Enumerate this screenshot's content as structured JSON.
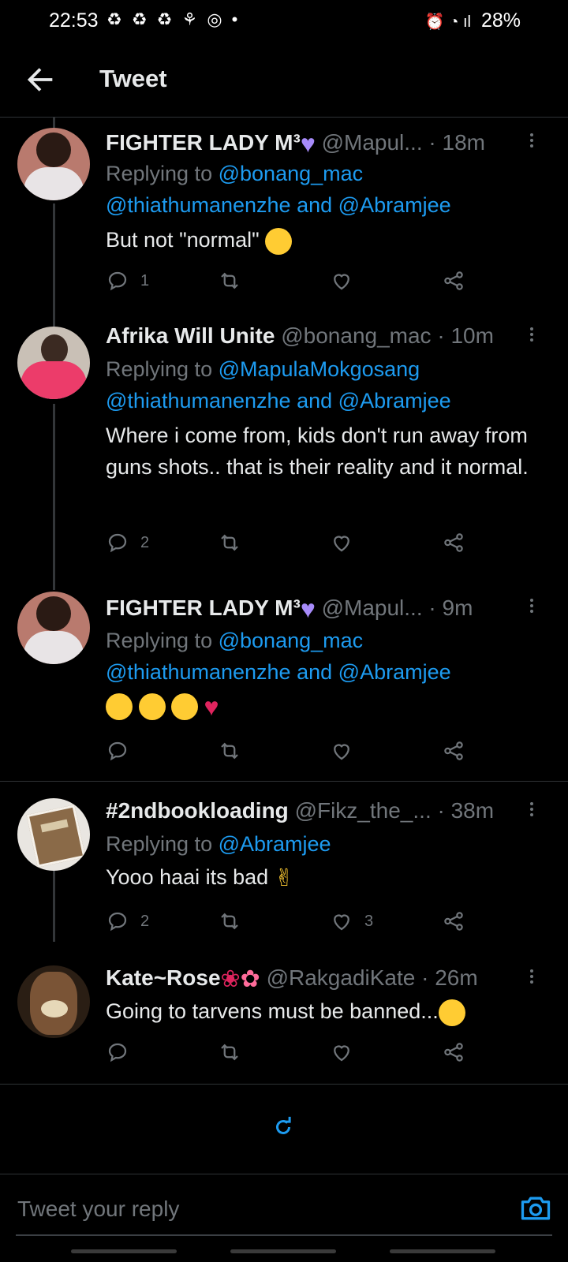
{
  "status_bar": {
    "time": "22:53",
    "left_icons": "♻ ♻ ♻ ⚘ ◎ •",
    "right_icons": "⏰ ◔ ıl",
    "battery": "28%"
  },
  "header": {
    "title": "Tweet",
    "back_icon": "arrow-left-icon"
  },
  "tweets": [
    {
      "name": "FIGHTER LADY M³",
      "handle": "@Mapul...",
      "sep": "·",
      "time": "18m",
      "replying_prefix": "Replying to",
      "replying_first": "@bonang_mac",
      "replying_second": "@thiathumanenzhe",
      "and": "and",
      "replying_third": "@Abramjee",
      "text": "But not \"normal\"",
      "reply_count": "1",
      "retweet_count": "",
      "like_count": ""
    },
    {
      "name": "Afrika Will Unite",
      "handle": "@bonang_mac",
      "sep": "·",
      "time": "10m",
      "replying_prefix": "Replying to",
      "replying_first": "@MapulaMokgosang",
      "replying_second": "@thiathumanenzhe",
      "and": "and",
      "replying_third": "@Abramjee",
      "text": "Where i come from, kids don't run away from guns shots.. that is their reality and it normal.",
      "reply_count": "2",
      "retweet_count": "",
      "like_count": ""
    },
    {
      "name": "FIGHTER LADY M³",
      "handle": "@Mapul...",
      "sep": "·",
      "time": "9m",
      "replying_prefix": "Replying to",
      "replying_first": "@bonang_mac",
      "replying_second": "@thiathumanenzhe",
      "and": "and",
      "replying_third": "@Abramjee",
      "text": "",
      "reply_count": "",
      "retweet_count": "",
      "like_count": ""
    },
    {
      "name": "#2ndbookloading",
      "handle": "@Fikz_the_...",
      "sep": "·",
      "time": "38m",
      "replying_prefix": "Replying to",
      "replying_first": "@Abramjee",
      "text": "Yooo haai its bad",
      "reply_count": "2",
      "retweet_count": "",
      "like_count": "3"
    },
    {
      "name": "Kate~Rose",
      "handle": "@RakgadiKate",
      "sep": "·",
      "time": "26m",
      "text": "Going to tarvens must be banned...",
      "reply_count": "",
      "retweet_count": "",
      "like_count": ""
    }
  ],
  "reply_bar": {
    "placeholder": "Tweet your reply",
    "camera_icon": "camera-icon"
  },
  "colors": {
    "background": "#000000",
    "text": "#e7e9ea",
    "secondary": "#71767b",
    "accent": "#1d9bf0",
    "divider": "#2f3336"
  }
}
